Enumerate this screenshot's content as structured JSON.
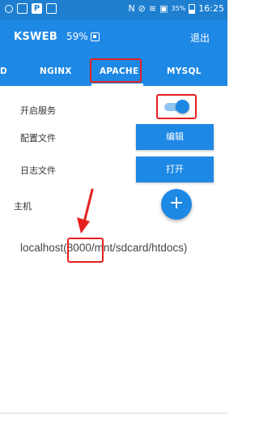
{
  "status_bar": {
    "signal_text": "N",
    "battery_percent": "35%",
    "time": "16:25"
  },
  "app_bar": {
    "title": "KSWEB",
    "cpu_usage": "59%",
    "exit_label": "退出"
  },
  "tabs": [
    {
      "label": "D",
      "selected": false
    },
    {
      "label": "NGINX",
      "selected": false
    },
    {
      "label": "APACHE",
      "selected": true
    },
    {
      "label": "MYSQL",
      "selected": false
    }
  ],
  "settings": {
    "service_label": "开启服务",
    "service_enabled": true,
    "config_label": "配置文件",
    "config_button": "编辑",
    "log_label": "日志文件",
    "log_button": "打开",
    "host_label": "主机",
    "add_host_button": "+"
  },
  "host_entry": {
    "host": "localhost",
    "port": "8000",
    "path": "/mnt/sdcard/htdocs"
  },
  "colors": {
    "accent": "#1e88e5",
    "annotation": "#e62020"
  },
  "icons": [
    "search-icon",
    "notification-icon",
    "p-app-icon",
    "image-icon",
    "nfc-icon",
    "mute-icon",
    "wifi-icon",
    "battery-saver-icon",
    "battery-icon",
    "cpu-chip-icon",
    "plus-icon"
  ]
}
